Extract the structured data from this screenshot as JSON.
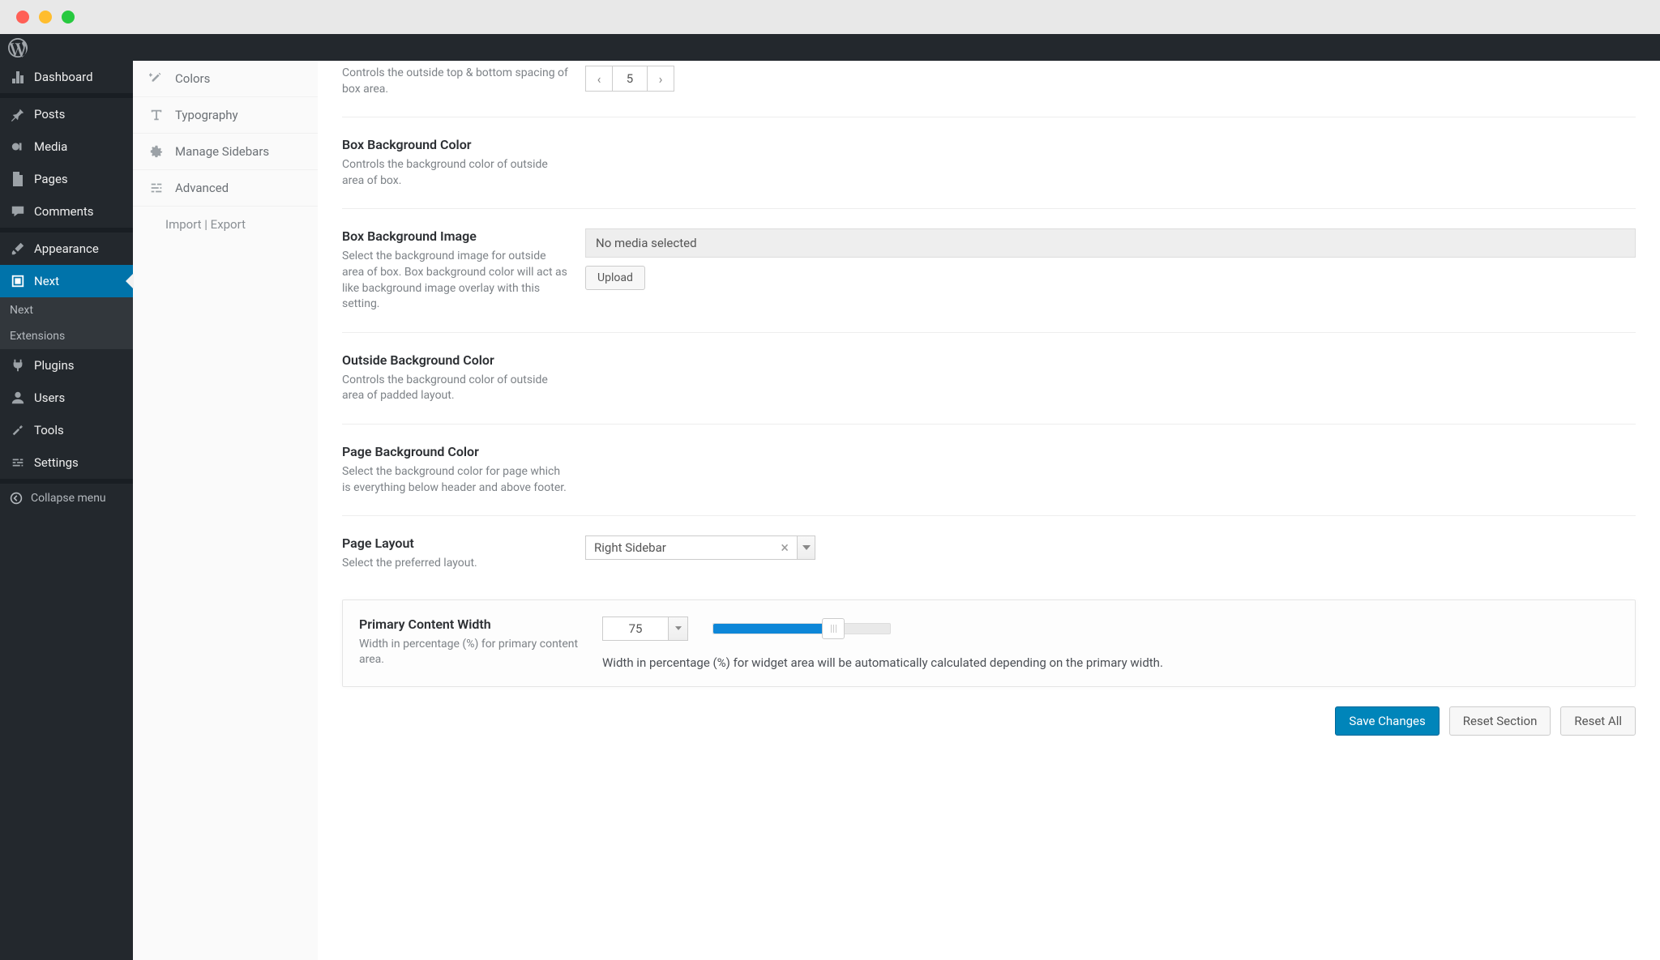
{
  "wp_menu": {
    "dashboard": "Dashboard",
    "posts": "Posts",
    "media": "Media",
    "pages": "Pages",
    "comments": "Comments",
    "appearance": "Appearance",
    "next": "Next",
    "next_sub1": "Next",
    "next_sub2": "Extensions",
    "plugins": "Plugins",
    "users": "Users",
    "tools": "Tools",
    "settings": "Settings",
    "collapse": "Collapse menu"
  },
  "settings_sidebar": {
    "colors": "Colors",
    "typography": "Typography",
    "manage_sidebars": "Manage Sidebars",
    "advanced": "Advanced",
    "import_export": "Import | Export"
  },
  "settings": {
    "box_spacing": {
      "title_visible": false,
      "desc": "Controls the outside top & bottom spacing of box area.",
      "value": "5"
    },
    "box_bg_color": {
      "title": "Box Background Color",
      "desc": "Controls the background color of outside area of box."
    },
    "box_bg_image": {
      "title": "Box Background Image",
      "desc": "Select the background image for outside area of box. Box background color will act as like background image overlay with this setting.",
      "media_text": "No media selected",
      "upload_label": "Upload"
    },
    "outside_bg_color": {
      "title": "Outside Background Color",
      "desc": "Controls the background color of outside area of padded layout."
    },
    "page_bg_color": {
      "title": "Page Background Color",
      "desc": "Select the background color for page which is everything below header and above footer."
    },
    "page_layout": {
      "title": "Page Layout",
      "desc": "Select the preferred layout.",
      "value": "Right Sidebar"
    },
    "primary_content_width": {
      "title": "Primary Content Width",
      "desc": "Width in percentage (%) for primary content area.",
      "value": "75",
      "note": "Width in percentage (%) for widget area will be automatically calculated depending on the primary width."
    }
  },
  "actions": {
    "save": "Save Changes",
    "reset_section": "Reset Section",
    "reset_all": "Reset All"
  }
}
